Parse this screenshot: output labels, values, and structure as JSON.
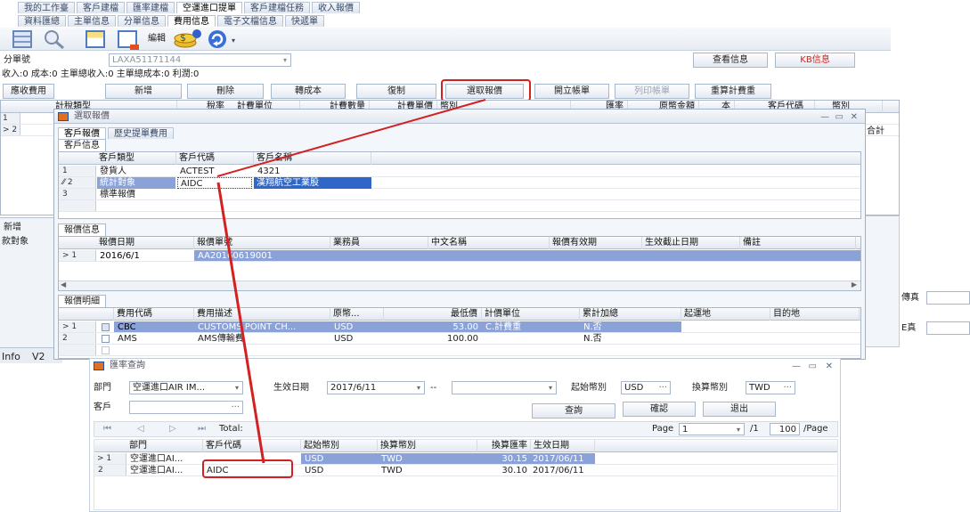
{
  "top_tabs": [
    "我的工作臺",
    "客戶建檔",
    "匯率建檔",
    "空運進口提單",
    "客戶建檔任務",
    "收入報價"
  ],
  "sub_tabs": [
    "資料匯總",
    "主單信息",
    "分單信息",
    "費用信息",
    "電子文檔信息",
    "快遞單"
  ],
  "toolbar": {
    "edit_label": "編輯"
  },
  "hawb": {
    "label": "分單號",
    "value": "LAXA51171144",
    "view_button": "查看信息",
    "kb_button": "KB信息"
  },
  "summary_line": "收入:0 成本:0 主單總收入:0 主單總成本:0 利潤:0",
  "action_buttons": [
    "應收費用",
    "新增",
    "刪除",
    "轉成本",
    "復制",
    "選取報價",
    "開立帳單",
    "列印帳單",
    "重算計費重"
  ],
  "fee_grid": {
    "headers": [
      "計稅類型",
      "稅率",
      "計費單位",
      "計費數量",
      "計費單價",
      "幣別",
      "匯率",
      "原幣金額",
      "本",
      "客戶代碼",
      "幣別"
    ],
    "row_numbers": [
      "1",
      "2"
    ],
    "right_label": "合計"
  },
  "quote_window": {
    "title": "選取報價",
    "tabs": [
      "客戶報價",
      "歷史提單費用"
    ],
    "customer_section": "客戶信息",
    "customer_headers": [
      "客戶類型",
      "客戶代碼",
      "客戶名稱"
    ],
    "customers": [
      {
        "no": "1",
        "type": "發貨人",
        "code": "ACTEST",
        "name": "4321"
      },
      {
        "no": "2",
        "type": "統計對象",
        "code": "AIDC",
        "name": "漢翔航空工業股"
      },
      {
        "no": "3",
        "type": "標準報價",
        "code": "",
        "name": ""
      }
    ],
    "quote_section": "報價信息",
    "quote_headers": [
      "報價日期",
      "報價單號",
      "業務員",
      "中文名稱",
      "報價有效期",
      "生效截止日期",
      "備註"
    ],
    "quotes": [
      {
        "no": "1",
        "date": "2016/6/1",
        "number": "AA20160619001"
      }
    ],
    "detail_section": "報價明細",
    "detail_headers": [
      "費用代碼",
      "費用描述",
      "原幣...",
      "最低價",
      "計價單位",
      "累計加總",
      "起運地",
      "目的地"
    ],
    "details": [
      {
        "no": "1",
        "code": "CBC",
        "desc": "CUSTOMS POINT CH...",
        "currency": "USD",
        "min": "53.00",
        "unit": "C.計費重",
        "cumulative": "N.否"
      },
      {
        "no": "2",
        "code": "AMS",
        "desc": "AMS傳輸費",
        "currency": "USD",
        "min": "100.00",
        "unit": "",
        "cumulative": "N.否"
      }
    ]
  },
  "left_fragments": {
    "new": "新增",
    "stat": "款對象",
    "info": "Info",
    "v2": "V2"
  },
  "right_fragments": [
    "傳真",
    "E真"
  ],
  "rate_window": {
    "title": "匯率查詢",
    "dept_label": "部門",
    "dept_value": "空運進口AIR IM...",
    "date_label": "生效日期",
    "date_value": "2017/6/11",
    "from_label": "起始幣別",
    "from_value": "USD",
    "to_label": "換算幣別",
    "to_value": "TWD",
    "customer_label": "客戶",
    "query_button": "查詢",
    "confirm_button": "確認",
    "exit_button": "退出",
    "total_label": "Total:",
    "page_label": "Page",
    "page_value": "1",
    "page_total": "/1",
    "page_size": "100",
    "page_suffix": "/Page",
    "headers": [
      "部門",
      "客戶代碼",
      "起始幣別",
      "換算幣別",
      "換算匯率",
      "生效日期"
    ],
    "rows": [
      {
        "no": "1",
        "dept": "空運進口AI...",
        "customer": "",
        "from": "USD",
        "to": "TWD",
        "rate": "30.15",
        "date": "2017/06/11"
      },
      {
        "no": "2",
        "dept": "空運進口AI...",
        "customer": "AIDC",
        "from": "USD",
        "to": "TWD",
        "rate": "30.10",
        "date": "2017/06/11"
      }
    ]
  },
  "colors": {
    "highlight": "#d42020",
    "selection": "#8aa2d8",
    "frame": "#9fb0c6"
  }
}
